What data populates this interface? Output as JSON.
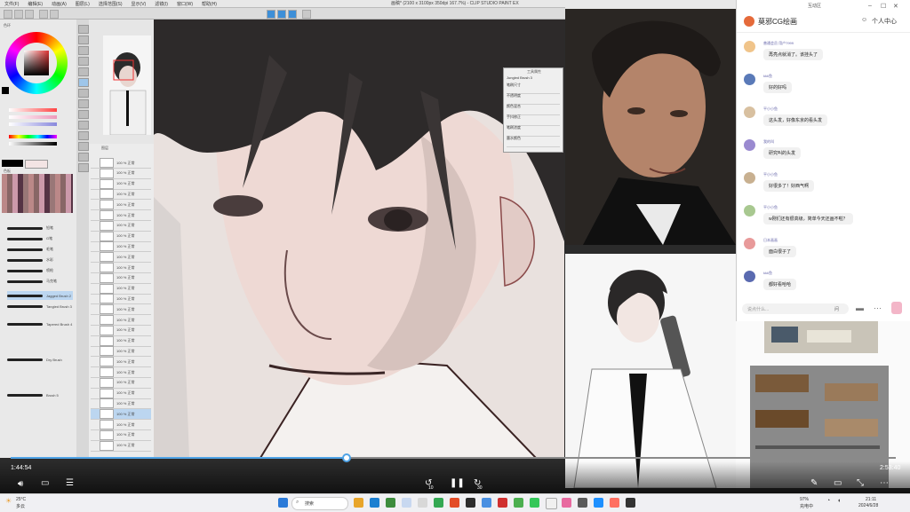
{
  "app": {
    "window_title": "画稿* (2100 x 3100px 350dpi 167.7%)  - CLIP STUDIO PAINT EX",
    "menu": [
      "文件(F)",
      "编辑(E)",
      "动画(A)",
      "图层(L)",
      "选择范围(S)",
      "显示(V)",
      "滤镜(I)",
      "窗口(W)",
      "帮助(H)"
    ]
  },
  "left_panel": {
    "color_wheel_label": "色环",
    "palette_label": "色板",
    "brushes": [
      "铅笔",
      "G笔",
      "毛笔",
      "水彩",
      "喷枪",
      "马克笔",
      "Jagged Brush 2",
      "Tangled Brush 3",
      "Tapered Brush 4",
      "Dry Brush",
      "Brush 5"
    ]
  },
  "layers": {
    "title": "图层",
    "items": [
      "100 % 正常",
      "100 % 正常",
      "100 % 正常",
      "100 % 正常",
      "100 % 正常",
      "100 % 正常",
      "100 % 正常",
      "100 % 正常",
      "100 % 正常",
      "100 % 正常",
      "100 % 正常",
      "100 % 正常",
      "100 % 正常",
      "100 % 正常",
      "100 % 正常",
      "100 % 正常",
      "100 % 正常",
      "100 % 正常",
      "100 % 正常",
      "100 % 正常",
      "100 % 正常",
      "100 % 正常",
      "100 % 正常",
      "100 % 正常",
      "100 % 正常",
      "100 % 正常",
      "100 % 正常",
      "100 % 正常"
    ]
  },
  "subtool_panel": {
    "title": "工具属性",
    "brush_name": "Jungled Brush 3",
    "rows": [
      "笔刷尺寸",
      "不透明度",
      "颜色混合",
      "手抖修正",
      "笔刷浓度",
      "墨水颜色"
    ]
  },
  "chat": {
    "header_title": "互动区",
    "channel_name": "莫邪CG绘画",
    "user_center": "个人中心",
    "messages": [
      {
        "name": "普通会员  用户7999",
        "text": "再亮点就消了。该挂头了"
      },
      {
        "name": "kkk鱼",
        "text": "好的好吗"
      },
      {
        "name": "平小小鱼",
        "text": "这头发，好像东京的看头发"
      },
      {
        "name": "我的叫",
        "text": "研究叫的头发"
      },
      {
        "name": "平小小鱼",
        "text": "好很多了！好西气啊"
      },
      {
        "name": "平小小鱼",
        "text": "w刚们还有很高级，简单今天还画不啦？"
      },
      {
        "name": "日本画画",
        "text": "面白很子了"
      },
      {
        "name": "kkk鱼",
        "text": "都好看哈哈"
      }
    ],
    "input_placeholder": "说点什么...",
    "send_label": "问"
  },
  "video": {
    "elapsed": "1:44:54",
    "duration": "2:53:40",
    "progress": 0.38,
    "rewind_label": "10",
    "forward_label": "30"
  },
  "taskbar": {
    "weather_temp": "25°C",
    "weather_desc": "多云",
    "search_placeholder": "搜索",
    "clock_time": "21:11",
    "clock_date": "2024/6/28",
    "battery": "97%",
    "battery_status": "充电中"
  },
  "colors": {
    "accent": "#4fa3e6",
    "progress_track": "#8a8a8a"
  }
}
